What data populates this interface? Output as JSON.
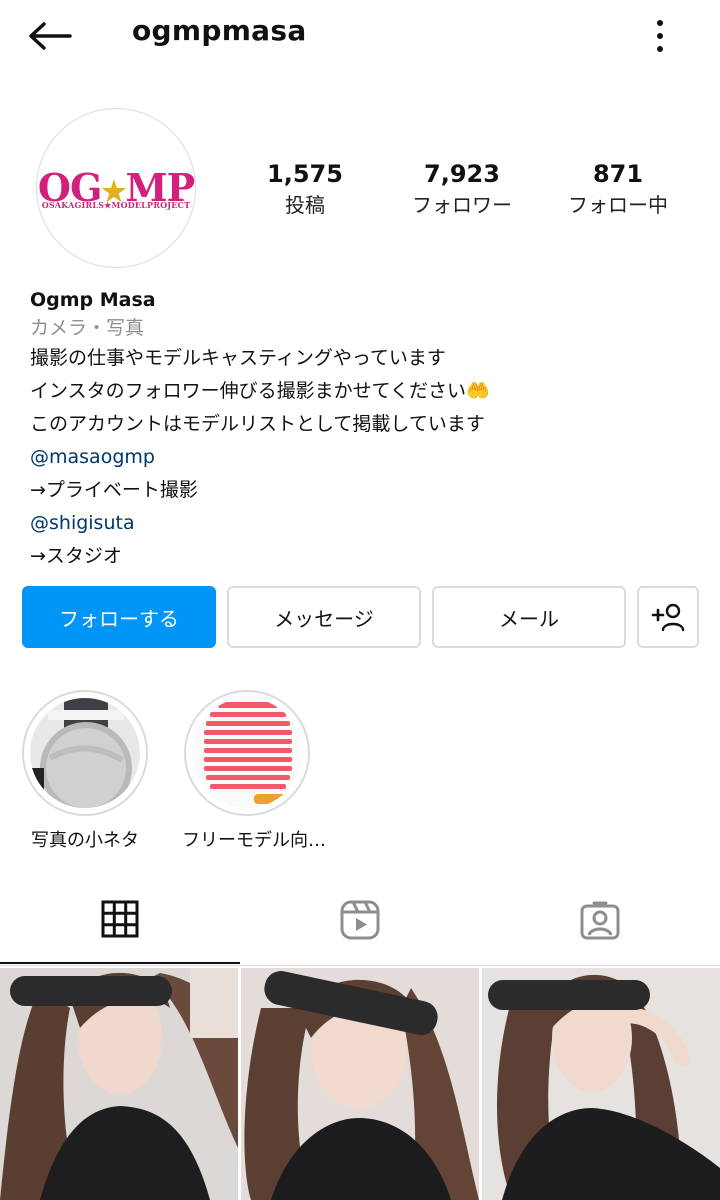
{
  "header": {
    "username": "ogmpmasa",
    "back_icon": "arrow-left-icon",
    "more_icon": "more-vertical-icon"
  },
  "avatar": {
    "logo_text_1": "OG",
    "logo_star": "★",
    "logo_text_2": "MP",
    "tagline": "OSAKAGIRLS★MODELPROJECT"
  },
  "stats": {
    "posts_count": "1,575",
    "posts_label": "投稿",
    "followers_count": "7,923",
    "followers_label": "フォロワー",
    "following_count": "871",
    "following_label": "フォロー中"
  },
  "bio": {
    "name": "Ogmp Masa",
    "category": "カメラ・写真",
    "line1": "撮影の仕事やモデルキャスティングやっています",
    "line2": "インスタのフォロワー伸びる撮影まかせてください🤲",
    "line3": "このアカウントはモデルリストとして掲載しています",
    "link1": "@masaogmp",
    "line4": "→プライベート撮影",
    "link2": "@shigisuta",
    "line5": "→スタジオ"
  },
  "actions": {
    "follow_label": "フォローする",
    "message_label": "メッセージ",
    "email_label": "メール",
    "add_user_icon": "add-person-icon"
  },
  "highlights": [
    {
      "label": "写真の小ネタ"
    },
    {
      "label": "フリーモデル向…"
    }
  ],
  "tabs": {
    "grid_icon": "grid-icon",
    "reels_icon": "reels-icon",
    "tagged_icon": "tagged-person-icon",
    "active": "grid"
  },
  "colors": {
    "accent": "#0095f6",
    "link": "#00376b",
    "muted": "#8e8e8e",
    "logo_pink": "#d2207c"
  }
}
